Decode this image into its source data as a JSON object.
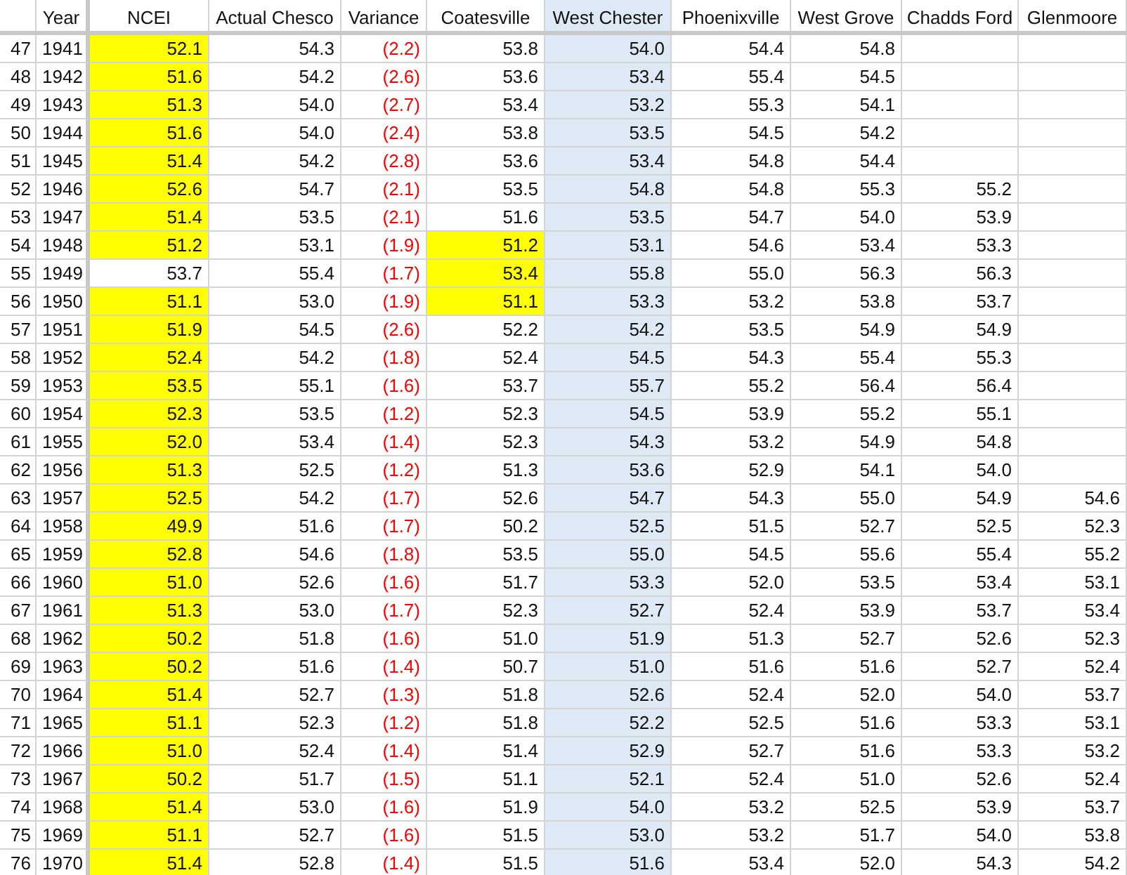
{
  "columns": [
    {
      "label": "Year",
      "kind": "year",
      "selected": false
    },
    {
      "label": "NCEI",
      "kind": "number",
      "selected": false
    },
    {
      "label": "Actual Chesco",
      "kind": "number",
      "selected": false
    },
    {
      "label": "Variance",
      "kind": "variance",
      "selected": false
    },
    {
      "label": "Coatesville",
      "kind": "number",
      "selected": false
    },
    {
      "label": "West Chester",
      "kind": "number",
      "selected": true
    },
    {
      "label": "Phoenixville",
      "kind": "number",
      "selected": false
    },
    {
      "label": "West Grove",
      "kind": "number",
      "selected": false
    },
    {
      "label": "Chadds Ford",
      "kind": "number",
      "selected": false
    },
    {
      "label": "Glenmoore",
      "kind": "number",
      "selected": false
    }
  ],
  "rows": [
    {
      "row": "47",
      "year": "1941",
      "cells": [
        {
          "value": "52.1",
          "highlighted": true
        },
        {
          "value": "54.3",
          "highlighted": false
        },
        {
          "value": "(2.2)",
          "highlighted": false
        },
        {
          "value": "53.8",
          "highlighted": false
        },
        {
          "value": "54.0",
          "highlighted": false
        },
        {
          "value": "54.4",
          "highlighted": false
        },
        {
          "value": "54.8",
          "highlighted": false
        },
        null,
        null
      ]
    },
    {
      "row": "48",
      "year": "1942",
      "cells": [
        {
          "value": "51.6",
          "highlighted": true
        },
        {
          "value": "54.2",
          "highlighted": false
        },
        {
          "value": "(2.6)",
          "highlighted": false
        },
        {
          "value": "53.6",
          "highlighted": false
        },
        {
          "value": "53.4",
          "highlighted": false
        },
        {
          "value": "55.4",
          "highlighted": false
        },
        {
          "value": "54.5",
          "highlighted": false
        },
        null,
        null
      ]
    },
    {
      "row": "49",
      "year": "1943",
      "cells": [
        {
          "value": "51.3",
          "highlighted": true
        },
        {
          "value": "54.0",
          "highlighted": false
        },
        {
          "value": "(2.7)",
          "highlighted": false
        },
        {
          "value": "53.4",
          "highlighted": false
        },
        {
          "value": "53.2",
          "highlighted": false
        },
        {
          "value": "55.3",
          "highlighted": false
        },
        {
          "value": "54.1",
          "highlighted": false
        },
        null,
        null
      ]
    },
    {
      "row": "50",
      "year": "1944",
      "cells": [
        {
          "value": "51.6",
          "highlighted": true
        },
        {
          "value": "54.0",
          "highlighted": false
        },
        {
          "value": "(2.4)",
          "highlighted": false
        },
        {
          "value": "53.8",
          "highlighted": false
        },
        {
          "value": "53.5",
          "highlighted": false
        },
        {
          "value": "54.5",
          "highlighted": false
        },
        {
          "value": "54.2",
          "highlighted": false
        },
        null,
        null
      ]
    },
    {
      "row": "51",
      "year": "1945",
      "cells": [
        {
          "value": "51.4",
          "highlighted": true
        },
        {
          "value": "54.2",
          "highlighted": false
        },
        {
          "value": "(2.8)",
          "highlighted": false
        },
        {
          "value": "53.6",
          "highlighted": false
        },
        {
          "value": "53.4",
          "highlighted": false
        },
        {
          "value": "54.8",
          "highlighted": false
        },
        {
          "value": "54.4",
          "highlighted": false
        },
        null,
        null
      ]
    },
    {
      "row": "52",
      "year": "1946",
      "cells": [
        {
          "value": "52.6",
          "highlighted": true
        },
        {
          "value": "54.7",
          "highlighted": false
        },
        {
          "value": "(2.1)",
          "highlighted": false
        },
        {
          "value": "53.5",
          "highlighted": false
        },
        {
          "value": "54.8",
          "highlighted": false
        },
        {
          "value": "54.8",
          "highlighted": false
        },
        {
          "value": "55.3",
          "highlighted": false
        },
        {
          "value": "55.2",
          "highlighted": false
        },
        null
      ]
    },
    {
      "row": "53",
      "year": "1947",
      "cells": [
        {
          "value": "51.4",
          "highlighted": true
        },
        {
          "value": "53.5",
          "highlighted": false
        },
        {
          "value": "(2.1)",
          "highlighted": false
        },
        {
          "value": "51.6",
          "highlighted": false
        },
        {
          "value": "53.5",
          "highlighted": false
        },
        {
          "value": "54.7",
          "highlighted": false
        },
        {
          "value": "54.0",
          "highlighted": false
        },
        {
          "value": "53.9",
          "highlighted": false
        },
        null
      ]
    },
    {
      "row": "54",
      "year": "1948",
      "cells": [
        {
          "value": "51.2",
          "highlighted": true
        },
        {
          "value": "53.1",
          "highlighted": false
        },
        {
          "value": "(1.9)",
          "highlighted": false
        },
        {
          "value": "51.2",
          "highlighted": true
        },
        {
          "value": "53.1",
          "highlighted": false
        },
        {
          "value": "54.6",
          "highlighted": false
        },
        {
          "value": "53.4",
          "highlighted": false
        },
        {
          "value": "53.3",
          "highlighted": false
        },
        null
      ]
    },
    {
      "row": "55",
      "year": "1949",
      "cells": [
        {
          "value": "53.7",
          "highlighted": false
        },
        {
          "value": "55.4",
          "highlighted": false
        },
        {
          "value": "(1.7)",
          "highlighted": false
        },
        {
          "value": "53.4",
          "highlighted": true
        },
        {
          "value": "55.8",
          "highlighted": false
        },
        {
          "value": "55.0",
          "highlighted": false
        },
        {
          "value": "56.3",
          "highlighted": false
        },
        {
          "value": "56.3",
          "highlighted": false
        },
        null
      ]
    },
    {
      "row": "56",
      "year": "1950",
      "cells": [
        {
          "value": "51.1",
          "highlighted": true
        },
        {
          "value": "53.0",
          "highlighted": false
        },
        {
          "value": "(1.9)",
          "highlighted": false
        },
        {
          "value": "51.1",
          "highlighted": true
        },
        {
          "value": "53.3",
          "highlighted": false
        },
        {
          "value": "53.2",
          "highlighted": false
        },
        {
          "value": "53.8",
          "highlighted": false
        },
        {
          "value": "53.7",
          "highlighted": false
        },
        null
      ]
    },
    {
      "row": "57",
      "year": "1951",
      "cells": [
        {
          "value": "51.9",
          "highlighted": true
        },
        {
          "value": "54.5",
          "highlighted": false
        },
        {
          "value": "(2.6)",
          "highlighted": false
        },
        {
          "value": "52.2",
          "highlighted": false
        },
        {
          "value": "54.2",
          "highlighted": false
        },
        {
          "value": "53.5",
          "highlighted": false
        },
        {
          "value": "54.9",
          "highlighted": false
        },
        {
          "value": "54.9",
          "highlighted": false
        },
        null
      ]
    },
    {
      "row": "58",
      "year": "1952",
      "cells": [
        {
          "value": "52.4",
          "highlighted": true
        },
        {
          "value": "54.2",
          "highlighted": false
        },
        {
          "value": "(1.8)",
          "highlighted": false
        },
        {
          "value": "52.4",
          "highlighted": false
        },
        {
          "value": "54.5",
          "highlighted": false
        },
        {
          "value": "54.3",
          "highlighted": false
        },
        {
          "value": "55.4",
          "highlighted": false
        },
        {
          "value": "55.3",
          "highlighted": false
        },
        null
      ]
    },
    {
      "row": "59",
      "year": "1953",
      "cells": [
        {
          "value": "53.5",
          "highlighted": true
        },
        {
          "value": "55.1",
          "highlighted": false
        },
        {
          "value": "(1.6)",
          "highlighted": false
        },
        {
          "value": "53.7",
          "highlighted": false
        },
        {
          "value": "55.7",
          "highlighted": false
        },
        {
          "value": "55.2",
          "highlighted": false
        },
        {
          "value": "56.4",
          "highlighted": false
        },
        {
          "value": "56.4",
          "highlighted": false
        },
        null
      ]
    },
    {
      "row": "60",
      "year": "1954",
      "cells": [
        {
          "value": "52.3",
          "highlighted": true
        },
        {
          "value": "53.5",
          "highlighted": false
        },
        {
          "value": "(1.2)",
          "highlighted": false
        },
        {
          "value": "52.3",
          "highlighted": false
        },
        {
          "value": "54.5",
          "highlighted": false
        },
        {
          "value": "53.9",
          "highlighted": false
        },
        {
          "value": "55.2",
          "highlighted": false
        },
        {
          "value": "55.1",
          "highlighted": false
        },
        null
      ]
    },
    {
      "row": "61",
      "year": "1955",
      "cells": [
        {
          "value": "52.0",
          "highlighted": true
        },
        {
          "value": "53.4",
          "highlighted": false
        },
        {
          "value": "(1.4)",
          "highlighted": false
        },
        {
          "value": "52.3",
          "highlighted": false
        },
        {
          "value": "54.3",
          "highlighted": false
        },
        {
          "value": "53.2",
          "highlighted": false
        },
        {
          "value": "54.9",
          "highlighted": false
        },
        {
          "value": "54.8",
          "highlighted": false
        },
        null
      ]
    },
    {
      "row": "62",
      "year": "1956",
      "cells": [
        {
          "value": "51.3",
          "highlighted": true
        },
        {
          "value": "52.5",
          "highlighted": false
        },
        {
          "value": "(1.2)",
          "highlighted": false
        },
        {
          "value": "51.3",
          "highlighted": false
        },
        {
          "value": "53.6",
          "highlighted": false
        },
        {
          "value": "52.9",
          "highlighted": false
        },
        {
          "value": "54.1",
          "highlighted": false
        },
        {
          "value": "54.0",
          "highlighted": false
        },
        null
      ]
    },
    {
      "row": "63",
      "year": "1957",
      "cells": [
        {
          "value": "52.5",
          "highlighted": true
        },
        {
          "value": "54.2",
          "highlighted": false
        },
        {
          "value": "(1.7)",
          "highlighted": false
        },
        {
          "value": "52.6",
          "highlighted": false
        },
        {
          "value": "54.7",
          "highlighted": false
        },
        {
          "value": "54.3",
          "highlighted": false
        },
        {
          "value": "55.0",
          "highlighted": false
        },
        {
          "value": "54.9",
          "highlighted": false
        },
        {
          "value": "54.6",
          "highlighted": false
        }
      ]
    },
    {
      "row": "64",
      "year": "1958",
      "cells": [
        {
          "value": "49.9",
          "highlighted": true
        },
        {
          "value": "51.6",
          "highlighted": false
        },
        {
          "value": "(1.7)",
          "highlighted": false
        },
        {
          "value": "50.2",
          "highlighted": false
        },
        {
          "value": "52.5",
          "highlighted": false
        },
        {
          "value": "51.5",
          "highlighted": false
        },
        {
          "value": "52.7",
          "highlighted": false
        },
        {
          "value": "52.5",
          "highlighted": false
        },
        {
          "value": "52.3",
          "highlighted": false
        }
      ]
    },
    {
      "row": "65",
      "year": "1959",
      "cells": [
        {
          "value": "52.8",
          "highlighted": true
        },
        {
          "value": "54.6",
          "highlighted": false
        },
        {
          "value": "(1.8)",
          "highlighted": false
        },
        {
          "value": "53.5",
          "highlighted": false
        },
        {
          "value": "55.0",
          "highlighted": false
        },
        {
          "value": "54.5",
          "highlighted": false
        },
        {
          "value": "55.6",
          "highlighted": false
        },
        {
          "value": "55.4",
          "highlighted": false
        },
        {
          "value": "55.2",
          "highlighted": false
        }
      ]
    },
    {
      "row": "66",
      "year": "1960",
      "cells": [
        {
          "value": "51.0",
          "highlighted": true
        },
        {
          "value": "52.6",
          "highlighted": false
        },
        {
          "value": "(1.6)",
          "highlighted": false
        },
        {
          "value": "51.7",
          "highlighted": false
        },
        {
          "value": "53.3",
          "highlighted": false
        },
        {
          "value": "52.0",
          "highlighted": false
        },
        {
          "value": "53.5",
          "highlighted": false
        },
        {
          "value": "53.4",
          "highlighted": false
        },
        {
          "value": "53.1",
          "highlighted": false
        }
      ]
    },
    {
      "row": "67",
      "year": "1961",
      "cells": [
        {
          "value": "51.3",
          "highlighted": true
        },
        {
          "value": "53.0",
          "highlighted": false
        },
        {
          "value": "(1.7)",
          "highlighted": false
        },
        {
          "value": "52.3",
          "highlighted": false
        },
        {
          "value": "52.7",
          "highlighted": false
        },
        {
          "value": "52.4",
          "highlighted": false
        },
        {
          "value": "53.9",
          "highlighted": false
        },
        {
          "value": "53.7",
          "highlighted": false
        },
        {
          "value": "53.4",
          "highlighted": false
        }
      ]
    },
    {
      "row": "68",
      "year": "1962",
      "cells": [
        {
          "value": "50.2",
          "highlighted": true
        },
        {
          "value": "51.8",
          "highlighted": false
        },
        {
          "value": "(1.6)",
          "highlighted": false
        },
        {
          "value": "51.0",
          "highlighted": false
        },
        {
          "value": "51.9",
          "highlighted": false
        },
        {
          "value": "51.3",
          "highlighted": false
        },
        {
          "value": "52.7",
          "highlighted": false
        },
        {
          "value": "52.6",
          "highlighted": false
        },
        {
          "value": "52.3",
          "highlighted": false
        }
      ]
    },
    {
      "row": "69",
      "year": "1963",
      "cells": [
        {
          "value": "50.2",
          "highlighted": true
        },
        {
          "value": "51.6",
          "highlighted": false
        },
        {
          "value": "(1.4)",
          "highlighted": false
        },
        {
          "value": "50.7",
          "highlighted": false
        },
        {
          "value": "51.0",
          "highlighted": false
        },
        {
          "value": "51.6",
          "highlighted": false
        },
        {
          "value": "51.6",
          "highlighted": false
        },
        {
          "value": "52.7",
          "highlighted": false
        },
        {
          "value": "52.4",
          "highlighted": false
        }
      ]
    },
    {
      "row": "70",
      "year": "1964",
      "cells": [
        {
          "value": "51.4",
          "highlighted": true
        },
        {
          "value": "52.7",
          "highlighted": false
        },
        {
          "value": "(1.3)",
          "highlighted": false
        },
        {
          "value": "51.8",
          "highlighted": false
        },
        {
          "value": "52.6",
          "highlighted": false
        },
        {
          "value": "52.4",
          "highlighted": false
        },
        {
          "value": "52.0",
          "highlighted": false
        },
        {
          "value": "54.0",
          "highlighted": false
        },
        {
          "value": "53.7",
          "highlighted": false
        }
      ]
    },
    {
      "row": "71",
      "year": "1965",
      "cells": [
        {
          "value": "51.1",
          "highlighted": true
        },
        {
          "value": "52.3",
          "highlighted": false
        },
        {
          "value": "(1.2)",
          "highlighted": false
        },
        {
          "value": "51.8",
          "highlighted": false
        },
        {
          "value": "52.2",
          "highlighted": false
        },
        {
          "value": "52.5",
          "highlighted": false
        },
        {
          "value": "51.6",
          "highlighted": false
        },
        {
          "value": "53.3",
          "highlighted": false
        },
        {
          "value": "53.1",
          "highlighted": false
        }
      ]
    },
    {
      "row": "72",
      "year": "1966",
      "cells": [
        {
          "value": "51.0",
          "highlighted": true
        },
        {
          "value": "52.4",
          "highlighted": false
        },
        {
          "value": "(1.4)",
          "highlighted": false
        },
        {
          "value": "51.4",
          "highlighted": false
        },
        {
          "value": "52.9",
          "highlighted": false
        },
        {
          "value": "52.7",
          "highlighted": false
        },
        {
          "value": "51.6",
          "highlighted": false
        },
        {
          "value": "53.3",
          "highlighted": false
        },
        {
          "value": "53.2",
          "highlighted": false
        }
      ]
    },
    {
      "row": "73",
      "year": "1967",
      "cells": [
        {
          "value": "50.2",
          "highlighted": true
        },
        {
          "value": "51.7",
          "highlighted": false
        },
        {
          "value": "(1.5)",
          "highlighted": false
        },
        {
          "value": "51.1",
          "highlighted": false
        },
        {
          "value": "52.1",
          "highlighted": false
        },
        {
          "value": "52.4",
          "highlighted": false
        },
        {
          "value": "51.0",
          "highlighted": false
        },
        {
          "value": "52.6",
          "highlighted": false
        },
        {
          "value": "52.4",
          "highlighted": false
        }
      ]
    },
    {
      "row": "74",
      "year": "1968",
      "cells": [
        {
          "value": "51.4",
          "highlighted": true
        },
        {
          "value": "53.0",
          "highlighted": false
        },
        {
          "value": "(1.6)",
          "highlighted": false
        },
        {
          "value": "51.9",
          "highlighted": false
        },
        {
          "value": "54.0",
          "highlighted": false
        },
        {
          "value": "53.2",
          "highlighted": false
        },
        {
          "value": "52.5",
          "highlighted": false
        },
        {
          "value": "53.9",
          "highlighted": false
        },
        {
          "value": "53.7",
          "highlighted": false
        }
      ]
    },
    {
      "row": "75",
      "year": "1969",
      "cells": [
        {
          "value": "51.1",
          "highlighted": true
        },
        {
          "value": "52.7",
          "highlighted": false
        },
        {
          "value": "(1.6)",
          "highlighted": false
        },
        {
          "value": "51.5",
          "highlighted": false
        },
        {
          "value": "53.0",
          "highlighted": false
        },
        {
          "value": "53.2",
          "highlighted": false
        },
        {
          "value": "51.7",
          "highlighted": false
        },
        {
          "value": "54.0",
          "highlighted": false
        },
        {
          "value": "53.8",
          "highlighted": false
        }
      ]
    },
    {
      "row": "76",
      "year": "1970",
      "cells": [
        {
          "value": "51.4",
          "highlighted": true
        },
        {
          "value": "52.8",
          "highlighted": false
        },
        {
          "value": "(1.4)",
          "highlighted": false
        },
        {
          "value": "51.5",
          "highlighted": false
        },
        {
          "value": "51.6",
          "highlighted": false
        },
        {
          "value": "53.4",
          "highlighted": false
        },
        {
          "value": "52.0",
          "highlighted": false
        },
        {
          "value": "54.3",
          "highlighted": false
        },
        {
          "value": "54.2",
          "highlighted": false
        }
      ]
    }
  ]
}
